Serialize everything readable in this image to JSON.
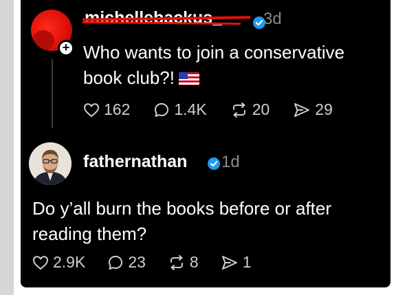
{
  "posts": [
    {
      "username": "michellebackus_",
      "time": "3d",
      "text": "Who wants to join a conservative book club?!",
      "stats": {
        "likes": "162",
        "replies": "1.4K",
        "reposts": "20",
        "shares": "29"
      }
    },
    {
      "username": "fathernathan",
      "time": "1d",
      "text": "Do y’all burn the books before or after reading them?",
      "stats": {
        "likes": "2.9K",
        "replies": "23",
        "reposts": "8",
        "shares": "1"
      }
    }
  ],
  "icons": {
    "like": "heart-icon",
    "reply": "comment-icon",
    "repost": "repost-icon",
    "share": "send-icon",
    "verified": "verified-badge-icon",
    "follow": "plus-icon",
    "flag": "us-flag-emoji"
  },
  "colors": {
    "card_bg": "#000000",
    "text": "#ffffff",
    "muted": "#8a8a8a",
    "verified": "#1d9bf0",
    "redaction": "#e0120a"
  }
}
